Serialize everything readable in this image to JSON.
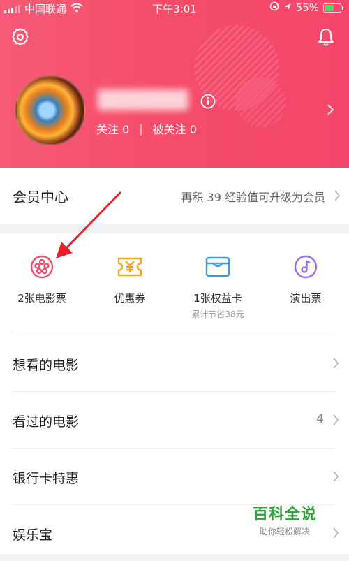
{
  "status_bar": {
    "carrier": "中国联通",
    "time": "下午3:01",
    "battery": "55%",
    "battery_level": 0.55,
    "battery_color": "#5ad35a"
  },
  "header": {
    "accent_color": "#f54d6a",
    "icons": [
      "gear-icon",
      "bell-icon",
      "info-icon",
      "chevron-right-icon"
    ],
    "follow_label": "关注 0",
    "followers_label": "被关注 0",
    "separator": "|"
  },
  "member": {
    "title": "会员中心",
    "hint": "再积 39 经验值可升级为会员"
  },
  "services": [
    {
      "label": "2张电影票",
      "sub": "",
      "icon": "film-reel-icon",
      "color": "#f04d6b"
    },
    {
      "label": "优惠券",
      "sub": "",
      "icon": "coupon-icon",
      "color": "#f5a524"
    },
    {
      "label": "1张权益卡",
      "sub": "累计节省38元",
      "icon": "card-icon",
      "color": "#3a9ae8"
    },
    {
      "label": "演出票",
      "sub": "",
      "icon": "music-disc-icon",
      "color": "#9b6cf0"
    }
  ],
  "list": [
    {
      "label": "想看的电影",
      "count": ""
    },
    {
      "label": "看过的电影",
      "count": "4"
    },
    {
      "label": "银行卡特惠",
      "count": ""
    },
    {
      "label": "娱乐宝",
      "count": ""
    }
  ],
  "annotation": {
    "color": "#e8202a"
  },
  "watermark": {
    "title": "百科全说",
    "subtitle": "助你轻松解决"
  }
}
